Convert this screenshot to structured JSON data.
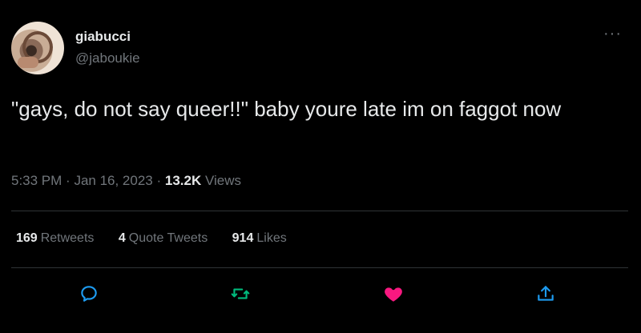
{
  "user": {
    "display_name": "giabucci",
    "handle": "@jaboukie",
    "avatar_icon": "profile-photo"
  },
  "more_icon": "more-dots-icon",
  "tweet": {
    "text": "\"gays, do not say queer!!\" baby youre late im on faggot now",
    "time": "5:33 PM",
    "date": "Jan 16, 2023",
    "views_count": "13.2K",
    "views_label": "Views"
  },
  "stats": [
    {
      "count": "169",
      "label": "Retweets"
    },
    {
      "count": "4",
      "label": "Quote Tweets"
    },
    {
      "count": "914",
      "label": "Likes"
    }
  ],
  "actions": {
    "reply_icon": "reply-icon",
    "retweet_icon": "retweet-icon",
    "like_icon": "heart-icon",
    "share_icon": "share-icon",
    "like_color": "#f91880",
    "retweet_color": "#00ba7c",
    "reply_color": "#1d9bf0",
    "share_color": "#1d9bf0"
  },
  "colors": {
    "background": "#000000",
    "text_primary": "#e7e9ea",
    "text_secondary": "#71767b",
    "divider": "#2f3336"
  }
}
